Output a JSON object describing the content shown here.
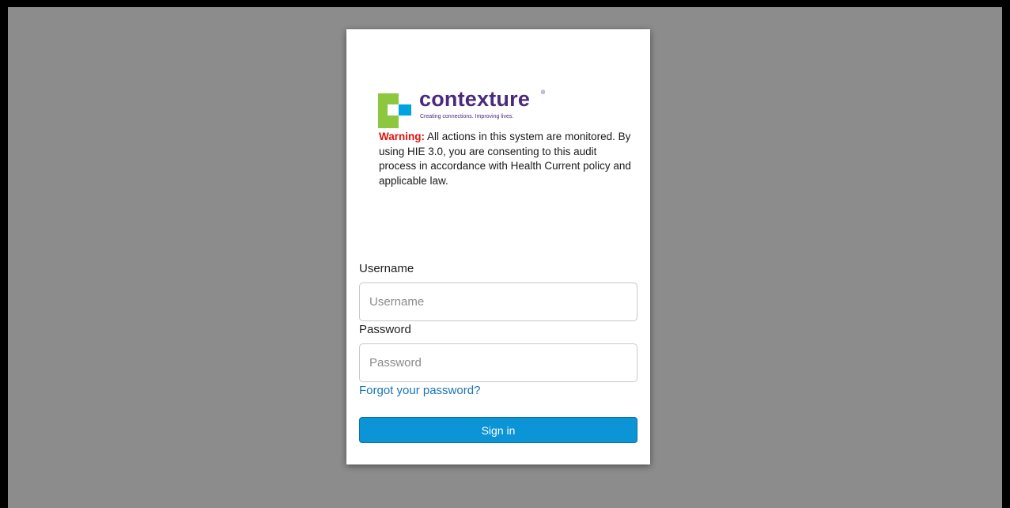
{
  "brand": {
    "name": "contexture",
    "registered_mark": "®",
    "tagline": "Creating connections. Improving lives.",
    "colors": {
      "purple": "#4b2a7e",
      "green": "#8dc63f",
      "blue": "#00a3e0"
    }
  },
  "notice": {
    "label": "Warning:",
    "text": " All actions in this system are monitored. By using HIE 3.0, you are consenting to this audit process in accordance with Health Current policy and applicable law."
  },
  "form": {
    "username_label": "Username",
    "username_placeholder": "Username",
    "username_value": "",
    "password_label": "Password",
    "password_placeholder": "Password",
    "password_value": "",
    "forgot_link": "Forgot your password?",
    "submit_label": "Sign in"
  },
  "colors": {
    "page_background": "#8c8c8c",
    "primary_button": "#0b94d6",
    "link": "#1a73b8",
    "warning": "#e3120b"
  }
}
